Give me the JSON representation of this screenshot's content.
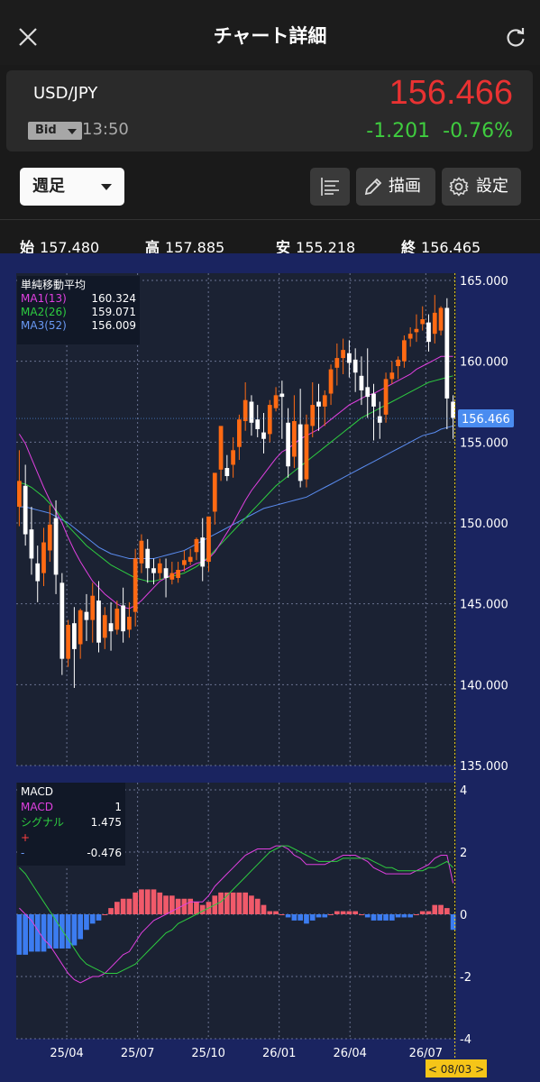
{
  "header": {
    "title": "チャート詳細"
  },
  "quote": {
    "pair": "USD/JPY",
    "bid_label": "Bid",
    "time": "13:50",
    "price": "156.466",
    "change": "-1.201",
    "change_pct": "-0.76%"
  },
  "toolbar": {
    "period": "週足",
    "draw_label": "描画",
    "settings_label": "設定"
  },
  "ohlc": [
    {
      "label": "始",
      "value": "157.480"
    },
    {
      "label": "高",
      "value": "157.885"
    },
    {
      "label": "安",
      "value": "155.218"
    },
    {
      "label": "終",
      "value": "156.465"
    }
  ],
  "ma_legend": {
    "title": "単純移動平均",
    "items": [
      {
        "label": "MA1(13)",
        "value": "160.324",
        "color": "#e040e0"
      },
      {
        "label": "MA2(26)",
        "value": "159.071",
        "color": "#2ecc40"
      },
      {
        "label": "MA3(52)",
        "value": "156.009",
        "color": "#5a8cf0"
      }
    ]
  },
  "macd_legend": {
    "title": "MACD",
    "items": [
      {
        "label": "MACD",
        "value": "1",
        "color": "#e040e0"
      },
      {
        "label": "シグナル",
        "value": "1.475",
        "color": "#2ecc40"
      },
      {
        "label": "+",
        "value": "",
        "color": "#ff4040"
      },
      {
        "label": "-",
        "value": "-0.476",
        "color": "#5a8cf0"
      }
    ]
  },
  "colors": {
    "up": "#ff6a13",
    "down": "#ffffff",
    "plus": "#f05a6a",
    "minus": "#3c7cf0"
  },
  "chart_data": {
    "type": "candlestick",
    "price_axis": {
      "ticks": [
        "165.000",
        "160.000",
        "155.000",
        "150.000",
        "145.000",
        "140.000",
        "135.000"
      ],
      "range": [
        135.0,
        165.0
      ]
    },
    "macd_axis": {
      "ticks": [
        "4",
        "2",
        "0",
        "-2",
        "-4"
      ],
      "range": [
        -4,
        4
      ]
    },
    "x_ticks": [
      "25/04",
      "25/07",
      "25/10",
      "26/01",
      "26/04",
      "26/07"
    ],
    "current_price_label": "156.466",
    "cursor_label": "< 08/03 >",
    "candles": [
      {
        "o": 151.0,
        "h": 154.5,
        "c": 152.6,
        "l": 149.8
      },
      {
        "o": 152.3,
        "h": 153.6,
        "c": 149.3,
        "l": 148.6
      },
      {
        "o": 149.6,
        "h": 151.0,
        "c": 147.8,
        "l": 146.8
      },
      {
        "o": 147.5,
        "h": 148.6,
        "c": 146.4,
        "l": 145.1
      },
      {
        "o": 146.9,
        "h": 149.7,
        "c": 148.8,
        "l": 146.1
      },
      {
        "o": 148.3,
        "h": 151.1,
        "c": 149.9,
        "l": 147.6
      },
      {
        "o": 150.3,
        "h": 151.4,
        "c": 146.8,
        "l": 145.6
      },
      {
        "o": 146.3,
        "h": 146.9,
        "c": 141.6,
        "l": 140.6
      },
      {
        "o": 141.6,
        "h": 144.0,
        "c": 143.7,
        "l": 141.1
      },
      {
        "o": 143.8,
        "h": 144.8,
        "c": 142.2,
        "l": 139.8
      },
      {
        "o": 142.5,
        "h": 144.7,
        "c": 144.6,
        "l": 141.6
      },
      {
        "o": 144.5,
        "h": 145.6,
        "c": 144.0,
        "l": 142.7
      },
      {
        "o": 144.0,
        "h": 146.3,
        "c": 145.5,
        "l": 142.6
      },
      {
        "o": 145.2,
        "h": 146.4,
        "c": 142.6,
        "l": 142.0
      },
      {
        "o": 142.9,
        "h": 144.8,
        "c": 144.3,
        "l": 142.2
      },
      {
        "o": 143.8,
        "h": 145.1,
        "c": 143.3,
        "l": 142.1
      },
      {
        "o": 143.4,
        "h": 145.2,
        "c": 144.7,
        "l": 143.1
      },
      {
        "o": 144.9,
        "h": 146.0,
        "c": 143.3,
        "l": 142.6
      },
      {
        "o": 143.4,
        "h": 145.1,
        "c": 144.2,
        "l": 142.9
      },
      {
        "o": 144.5,
        "h": 148.4,
        "c": 147.8,
        "l": 143.6
      },
      {
        "o": 147.5,
        "h": 149.3,
        "c": 148.9,
        "l": 146.9
      },
      {
        "o": 148.4,
        "h": 149.0,
        "c": 147.2,
        "l": 146.3
      },
      {
        "o": 147.2,
        "h": 147.8,
        "c": 146.9,
        "l": 146.2
      },
      {
        "o": 146.9,
        "h": 147.8,
        "c": 147.5,
        "l": 146.5
      },
      {
        "o": 147.2,
        "h": 147.8,
        "c": 146.6,
        "l": 145.4
      },
      {
        "o": 146.5,
        "h": 147.6,
        "c": 146.9,
        "l": 146.2
      },
      {
        "o": 146.6,
        "h": 147.6,
        "c": 147.1,
        "l": 146.3
      },
      {
        "o": 147.4,
        "h": 148.3,
        "c": 147.7,
        "l": 147.0
      },
      {
        "o": 147.6,
        "h": 148.4,
        "c": 147.9,
        "l": 147.4
      },
      {
        "o": 148.2,
        "h": 149.1,
        "c": 149.0,
        "l": 147.7
      },
      {
        "o": 149.1,
        "h": 150.3,
        "c": 147.3,
        "l": 146.4
      },
      {
        "o": 147.6,
        "h": 149.5,
        "c": 150.4,
        "l": 147.0
      },
      {
        "o": 150.7,
        "h": 152.0,
        "c": 153.1,
        "l": 149.9
      },
      {
        "o": 153.3,
        "h": 154.3,
        "c": 156.0,
        "l": 152.6
      },
      {
        "o": 153.4,
        "h": 154.2,
        "c": 152.9,
        "l": 152.6
      },
      {
        "o": 153.6,
        "h": 155.3,
        "c": 154.5,
        "l": 152.8
      },
      {
        "o": 154.7,
        "h": 156.7,
        "c": 156.4,
        "l": 153.9
      },
      {
        "o": 156.3,
        "h": 158.7,
        "c": 157.6,
        "l": 155.7
      },
      {
        "o": 157.5,
        "h": 157.9,
        "c": 156.2,
        "l": 155.4
      },
      {
        "o": 156.4,
        "h": 157.3,
        "c": 155.8,
        "l": 155.3
      },
      {
        "o": 155.6,
        "h": 156.8,
        "c": 155.2,
        "l": 154.3
      },
      {
        "o": 155.5,
        "h": 157.6,
        "c": 157.3,
        "l": 155.0
      },
      {
        "o": 157.1,
        "h": 158.4,
        "c": 157.9,
        "l": 156.9
      },
      {
        "o": 158.0,
        "h": 158.8,
        "c": 157.8,
        "l": 155.2
      },
      {
        "o": 156.2,
        "h": 157.1,
        "c": 153.5,
        "l": 152.8
      },
      {
        "o": 154.1,
        "h": 157.9,
        "c": 156.3,
        "l": 153.4
      },
      {
        "o": 156.1,
        "h": 158.3,
        "c": 152.6,
        "l": 152.2
      },
      {
        "o": 152.7,
        "h": 156.7,
        "c": 156.1,
        "l": 152.2
      },
      {
        "o": 156.0,
        "h": 158.7,
        "c": 157.3,
        "l": 155.3
      },
      {
        "o": 157.5,
        "h": 158.6,
        "c": 157.2,
        "l": 155.7
      },
      {
        "o": 157.2,
        "h": 158.2,
        "c": 157.9,
        "l": 156.0
      },
      {
        "o": 158.0,
        "h": 159.8,
        "c": 159.5,
        "l": 157.3
      },
      {
        "o": 159.6,
        "h": 161.1,
        "c": 160.2,
        "l": 158.5
      },
      {
        "o": 160.2,
        "h": 161.4,
        "c": 160.7,
        "l": 159.2
      },
      {
        "o": 160.5,
        "h": 161.3,
        "c": 159.9,
        "l": 159.0
      },
      {
        "o": 160.1,
        "h": 160.8,
        "c": 159.3,
        "l": 158.1
      },
      {
        "o": 159.1,
        "h": 160.3,
        "c": 158.2,
        "l": 157.3
      },
      {
        "o": 158.4,
        "h": 160.8,
        "c": 157.8,
        "l": 156.5
      },
      {
        "o": 158.0,
        "h": 158.6,
        "c": 157.2,
        "l": 155.1
      },
      {
        "o": 156.6,
        "h": 157.5,
        "c": 156.2,
        "l": 155.2
      },
      {
        "o": 156.7,
        "h": 159.3,
        "c": 158.9,
        "l": 156.2
      },
      {
        "o": 158.9,
        "h": 160.0,
        "c": 159.3,
        "l": 158.6
      },
      {
        "o": 159.7,
        "h": 160.3,
        "c": 160.1,
        "l": 158.9
      },
      {
        "o": 160.0,
        "h": 161.6,
        "c": 161.3,
        "l": 159.6
      },
      {
        "o": 161.4,
        "h": 162.1,
        "c": 161.7,
        "l": 160.9
      },
      {
        "o": 161.8,
        "h": 162.9,
        "c": 162.0,
        "l": 161.2
      },
      {
        "o": 162.3,
        "h": 163.4,
        "c": 162.6,
        "l": 161.9
      },
      {
        "o": 162.4,
        "h": 162.9,
        "c": 161.2,
        "l": 160.6
      },
      {
        "o": 161.7,
        "h": 164.1,
        "c": 163.0,
        "l": 161.1
      },
      {
        "o": 161.9,
        "h": 163.4,
        "c": 163.3,
        "l": 161.6
      },
      {
        "o": 163.3,
        "h": 163.9,
        "c": 157.7,
        "l": 155.8
      },
      {
        "o": 157.5,
        "h": 157.9,
        "c": 156.5,
        "l": 155.2
      }
    ],
    "ma1": [
      155.5,
      154.9,
      154.0,
      153.1,
      152.2,
      151.4,
      150.7,
      150.0,
      149.1,
      148.3,
      147.6,
      147.0,
      146.4,
      146.0,
      145.6,
      145.3,
      145.0,
      144.8,
      144.7,
      144.9,
      145.2,
      145.6,
      146.0,
      146.4,
      146.6,
      146.8,
      147.0,
      147.1,
      147.3,
      147.5,
      147.6,
      147.8,
      148.2,
      148.8,
      149.4,
      150.0,
      150.7,
      151.4,
      152.0,
      152.5,
      153.0,
      153.5,
      154.0,
      154.4,
      154.6,
      154.9,
      155.2,
      155.4,
      155.6,
      155.8,
      156.1,
      156.4,
      156.7,
      157.0,
      157.3,
      157.5,
      157.7,
      157.9,
      158.0,
      158.2,
      158.4,
      158.6,
      158.8,
      159.0,
      159.2,
      159.5,
      159.7,
      159.9,
      160.1,
      160.3,
      160.3,
      160.3
    ],
    "ma2": [
      152.5,
      152.4,
      152.2,
      151.9,
      151.6,
      151.2,
      150.8,
      150.3,
      149.8,
      149.4,
      149.0,
      148.6,
      148.3,
      148.0,
      147.7,
      147.4,
      147.2,
      147.0,
      146.8,
      146.6,
      146.5,
      146.4,
      146.4,
      146.5,
      146.6,
      146.7,
      146.8,
      146.9,
      147.1,
      147.3,
      147.6,
      147.9,
      148.3,
      148.7,
      149.1,
      149.5,
      149.9,
      150.3,
      150.7,
      151.1,
      151.5,
      151.9,
      152.3,
      152.6,
      152.9,
      153.2,
      153.5,
      153.8,
      154.1,
      154.4,
      154.7,
      155.0,
      155.3,
      155.6,
      155.9,
      156.2,
      156.5,
      156.7,
      156.9,
      157.1,
      157.3,
      157.5,
      157.7,
      157.9,
      158.1,
      158.3,
      158.5,
      158.7,
      158.8,
      158.9,
      159.0,
      159.1
    ],
    "ma3": [
      151.0,
      151.0,
      150.9,
      150.8,
      150.7,
      150.6,
      150.4,
      150.2,
      150.0,
      149.7,
      149.4,
      149.1,
      148.8,
      148.5,
      148.3,
      148.1,
      148.0,
      147.9,
      147.8,
      147.8,
      147.8,
      147.8,
      147.8,
      147.9,
      148.0,
      148.1,
      148.2,
      148.3,
      148.5,
      148.7,
      148.9,
      149.1,
      149.3,
      149.5,
      149.7,
      149.9,
      150.1,
      150.3,
      150.5,
      150.7,
      150.9,
      151.0,
      151.1,
      151.2,
      151.3,
      151.4,
      151.5,
      151.6,
      151.8,
      152.0,
      152.2,
      152.4,
      152.6,
      152.8,
      153.0,
      153.2,
      153.4,
      153.6,
      153.8,
      154.0,
      154.2,
      154.4,
      154.6,
      154.8,
      155.0,
      155.2,
      155.4,
      155.5,
      155.6,
      155.8,
      155.9,
      156.0
    ],
    "macd": [
      0.2,
      0.0,
      -0.2,
      -0.5,
      -0.8,
      -1.0,
      -1.3,
      -1.6,
      -1.9,
      -2.1,
      -2.2,
      -2.1,
      -2.0,
      -2.0,
      -1.9,
      -1.7,
      -1.5,
      -1.3,
      -1.2,
      -0.9,
      -0.6,
      -0.4,
      -0.2,
      -0.1,
      0.0,
      0.1,
      0.2,
      0.3,
      0.4,
      0.4,
      0.4,
      0.6,
      0.9,
      1.1,
      1.3,
      1.5,
      1.7,
      1.9,
      2.0,
      2.1,
      2.1,
      2.1,
      2.2,
      2.2,
      2.1,
      1.9,
      1.8,
      1.6,
      1.6,
      1.6,
      1.6,
      1.7,
      1.8,
      1.9,
      1.9,
      1.9,
      1.8,
      1.7,
      1.5,
      1.4,
      1.3,
      1.3,
      1.3,
      1.3,
      1.3,
      1.4,
      1.5,
      1.6,
      1.8,
      1.9,
      1.9,
      1.0
    ],
    "signal": [
      1.5,
      1.3,
      1.0,
      0.7,
      0.4,
      0.1,
      -0.2,
      -0.5,
      -0.8,
      -1.1,
      -1.4,
      -1.6,
      -1.7,
      -1.8,
      -1.9,
      -1.9,
      -1.9,
      -1.8,
      -1.7,
      -1.6,
      -1.4,
      -1.2,
      -1.0,
      -0.8,
      -0.6,
      -0.5,
      -0.3,
      -0.2,
      -0.1,
      0.0,
      0.1,
      0.2,
      0.3,
      0.4,
      0.6,
      0.8,
      1.0,
      1.2,
      1.4,
      1.6,
      1.8,
      2.0,
      2.1,
      2.2,
      2.2,
      2.1,
      2.0,
      1.9,
      1.8,
      1.7,
      1.7,
      1.7,
      1.7,
      1.8,
      1.8,
      1.8,
      1.8,
      1.8,
      1.7,
      1.6,
      1.5,
      1.5,
      1.4,
      1.4,
      1.4,
      1.4,
      1.4,
      1.5,
      1.5,
      1.6,
      1.7,
      1.5
    ],
    "histogram": [
      -1.3,
      -1.3,
      -1.2,
      -1.2,
      -1.2,
      -1.1,
      -1.1,
      -1.1,
      -1.1,
      -1.0,
      -0.8,
      -0.5,
      -0.3,
      -0.2,
      0.0,
      0.2,
      0.4,
      0.5,
      0.5,
      0.7,
      0.8,
      0.8,
      0.8,
      0.7,
      0.6,
      0.6,
      0.5,
      0.5,
      0.5,
      0.4,
      0.3,
      0.4,
      0.6,
      0.7,
      0.7,
      0.7,
      0.7,
      0.7,
      0.6,
      0.5,
      0.3,
      0.1,
      0.1,
      0.0,
      -0.1,
      -0.2,
      -0.2,
      -0.3,
      -0.2,
      -0.1,
      -0.1,
      0.0,
      0.1,
      0.1,
      0.1,
      0.1,
      0.0,
      -0.1,
      -0.2,
      -0.2,
      -0.2,
      -0.2,
      -0.1,
      -0.1,
      -0.1,
      0.0,
      0.1,
      0.1,
      0.3,
      0.3,
      0.2,
      -0.5
    ]
  }
}
